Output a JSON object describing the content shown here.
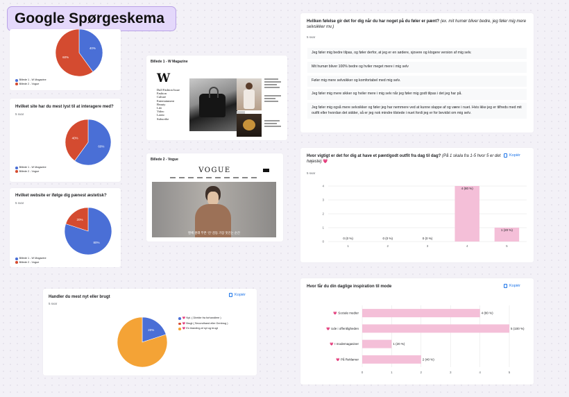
{
  "page_title": "Google Spørgeskema",
  "colors": {
    "blue": "#4a6fd6",
    "red": "#d44b30",
    "orange": "#f4a336",
    "pink": "#f4bfd8",
    "accent": "#1a73e8"
  },
  "copy_label": "Kopiér",
  "legend_sites": [
    "Billede 1 - W Magazine",
    "Billede 2 - Vogue"
  ],
  "pie1": {
    "chart_data": {
      "type": "pie",
      "labels": [
        "Billede 1 - W Magazine",
        "Billede 2 - Vogue"
      ],
      "values": [
        40,
        60
      ],
      "slice_labels": [
        "40%",
        "60%"
      ]
    }
  },
  "pie2": {
    "question": "Hvilket site har du mest lyst til at interagere med?",
    "count": "5 svar",
    "chart_data": {
      "type": "pie",
      "labels": [
        "Billede 1 - W Magazine",
        "Billede 2 - Vogue"
      ],
      "values": [
        60,
        40
      ],
      "slice_labels": [
        "60%",
        "40%"
      ]
    }
  },
  "pie3": {
    "question": "Hvilket website er ifølge dig pænest æstetisk?",
    "count": "5 svar",
    "chart_data": {
      "type": "pie",
      "labels": [
        "Billede 1 - W Magazine",
        "Billede 2 - Vogue"
      ],
      "values": [
        80,
        20
      ],
      "slice_labels": [
        "80%",
        "20%"
      ]
    }
  },
  "img1": {
    "header": "Billede 1 - W Magazine",
    "logo": "W",
    "menu": [
      "Dull Fashion Issue",
      "Fashion",
      "Culture",
      "Entertainment",
      "Beauty",
      "Life",
      "Video",
      "Latest",
      "Subscribe"
    ]
  },
  "img2": {
    "header": "Billede 2 - Vogue",
    "logo": "VOGUE",
    "caption": "맨체 원래 부촌 ‘진’ 감동 가장 멋진는 순간"
  },
  "pie4": {
    "question": "Handler du mest nyt eller brugt",
    "count": "5 svar",
    "legend": [
      "💗 Nyt. ( Direkte fra forhandlere )",
      "💗 Brugt ( Secondhand eller Genbrug )",
      "💗 En blanding af nyt og brugt"
    ],
    "chart_data": {
      "type": "pie",
      "labels": [
        "Nyt",
        "Brugt",
        "En blanding af nyt og brugt"
      ],
      "values": [
        20,
        0,
        80
      ],
      "slice_labels": [
        "20%",
        "80%"
      ]
    }
  },
  "feelings": {
    "question": "Hvilken følelse gir det for dig når du har noget på du føler er pænt?",
    "hint": "(ex. mit humør bliver bedre, jeg føler mig mere selvsikker mv.)",
    "count": "5 svar",
    "responses": [
      "Jeg føler mig bedre tilpas, og føler derfor, at jeg er en sødere, sjovere og klogere version af mig selv.",
      "Mit humør bliver 100% bedre og hviler meget mere i mig selv",
      "Føler mig mere selvsikker og komfortabel med mig selv.",
      "Jeg føler mig mere sikker og hviler mere i mig selv når jeg føler mig godt tilpas i det jeg har på.",
      "Jeg føler mig også mere selvsikker og føler jeg har nemmere ved at kunne slappe af og være i nuet. Hvis ikke jeg er tilfreds med mit outfit eller hvordan det sidder, så er jeg nok mindre tilstede i nuet fordi jeg er for bevidst om mig selv."
    ]
  },
  "importance": {
    "question": "Hvor vigtigt er det for dig at have et pænt/godt outfit fra dag til dag?",
    "hint": "(På 1 skala fra 1-5 hvor 5 er det højeste)",
    "suffix": "💗",
    "count": "5 svar",
    "chart_data": {
      "type": "bar",
      "categories": [
        "1",
        "2",
        "3",
        "4",
        "5"
      ],
      "values": [
        0,
        0,
        0,
        4,
        1
      ],
      "data_labels": [
        "0 (0 %)",
        "0 (0 %)",
        "0 (0 %)",
        "4 (80 %)",
        "1 (20 %)"
      ],
      "yticks": [
        "0",
        "1",
        "2",
        "3",
        "4"
      ],
      "ylim": [
        0,
        4
      ]
    }
  },
  "inspiration": {
    "question": "Hvor får du din daglige inspiration til mode",
    "chart_data": {
      "type": "bar",
      "orientation": "horizontal",
      "categories": [
        "💗 Sociale medier",
        "💗 Ude i offentligheden",
        "💗 I modemagasiner",
        "💗 Pǻ Reklamer"
      ],
      "values": [
        4,
        5,
        1,
        2
      ],
      "data_labels": [
        "4 (80 %)",
        "5 (100 %)",
        "1 (20 %)",
        "2 (40 %)"
      ],
      "xticks": [
        "0",
        "1",
        "2",
        "3",
        "4",
        "5"
      ],
      "xlim": [
        0,
        5
      ]
    }
  }
}
